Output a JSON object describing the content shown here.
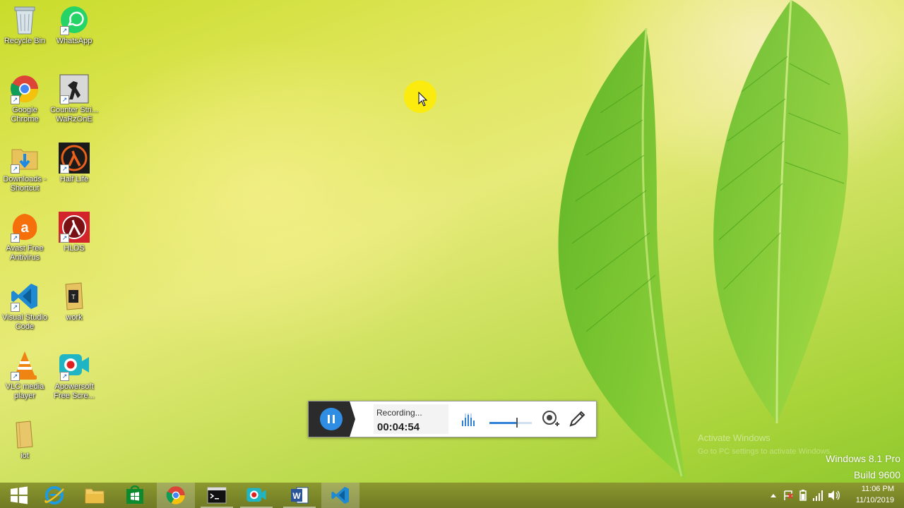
{
  "desktop_icons": [
    {
      "label": "Recycle Bin",
      "icon": "recycle-bin-icon"
    },
    {
      "label": "WhatsApp",
      "icon": "whatsapp-icon"
    },
    {
      "label": "Google Chrome",
      "icon": "chrome-icon"
    },
    {
      "label": "Counter Stri... WaRzOnE",
      "icon": "counter-strike-icon"
    },
    {
      "label": "Downloads - Shortcut",
      "icon": "folder-downloads-icon"
    },
    {
      "label": "Half Life",
      "icon": "half-life-icon"
    },
    {
      "label": "Avast Free Antivirus",
      "icon": "avast-icon"
    },
    {
      "label": "HLDS",
      "icon": "hlds-icon"
    },
    {
      "label": "Visual Studio Code",
      "icon": "vscode-icon"
    },
    {
      "label": "work",
      "icon": "folder-work-icon"
    },
    {
      "label": "VLC media player",
      "icon": "vlc-icon"
    },
    {
      "label": "Apowersoft Free Scre...",
      "icon": "apowersoft-icon"
    },
    {
      "label": "iot",
      "icon": "folder-iot-icon"
    }
  ],
  "recorder": {
    "status": "Recording...",
    "time": "00:04:54",
    "volume_level": 0.65
  },
  "watermark": {
    "edition": "Windows 8.1 Pro",
    "build": "Build 9600",
    "activate": "Activate Windows",
    "activate_sub": "Go to PC settings to activate Windows."
  },
  "taskbar": {
    "items": [
      {
        "name": "start-button",
        "icon": "windows-logo-icon"
      },
      {
        "name": "internet-explorer",
        "icon": "ie-icon"
      },
      {
        "name": "file-explorer",
        "icon": "file-explorer-icon"
      },
      {
        "name": "store",
        "icon": "store-icon"
      },
      {
        "name": "chrome",
        "icon": "chrome-icon"
      },
      {
        "name": "command-prompt",
        "icon": "cmd-icon"
      },
      {
        "name": "apowersoft-recorder",
        "icon": "apowersoft-icon"
      },
      {
        "name": "word",
        "icon": "word-icon"
      },
      {
        "name": "vscode",
        "icon": "vscode-icon"
      }
    ],
    "clock_time": "11:06 PM",
    "clock_date": "11/10/2019"
  }
}
